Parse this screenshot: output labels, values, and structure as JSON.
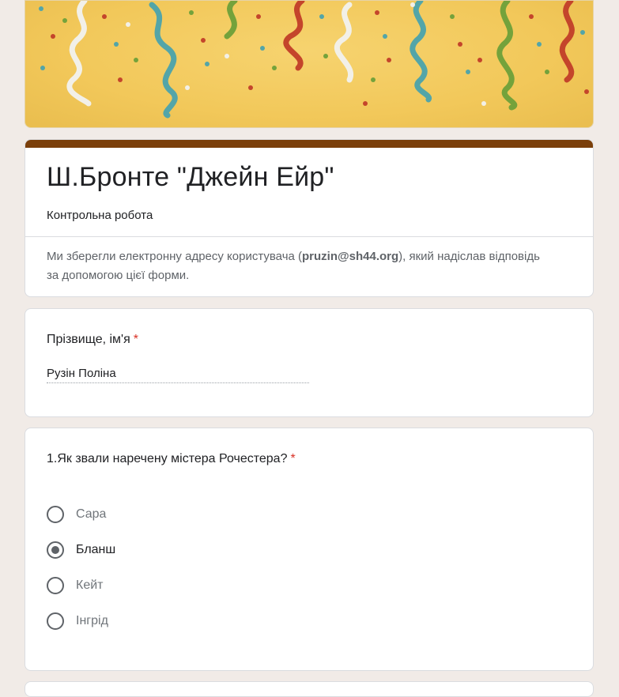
{
  "colors": {
    "page_bg": "#f1ebe7",
    "theme_accent": "#7b3f0a",
    "banner_bg": "#f2c85a",
    "required_star": "#d93025"
  },
  "form": {
    "title": "Ш.Бронте \"Джейн Ейр\"",
    "description": "Контрольна робота",
    "email_prefix": "Ми зберегли електронну адресу користувача (",
    "email": "pruzin@sh44.org",
    "email_suffix": "), який надіслав відповідь за допомогою цієї форми."
  },
  "questions": {
    "name": {
      "title": "Прізвище, ім'я",
      "required_mark": "*",
      "answer": "Рузін Поліна"
    },
    "q1": {
      "title": "1.Як звали наречену містера Рочестера?",
      "required_mark": "*",
      "options": [
        {
          "label": "Сара",
          "selected": false
        },
        {
          "label": "Бланш",
          "selected": true
        },
        {
          "label": "Кейт",
          "selected": false
        },
        {
          "label": "Інгрід",
          "selected": false
        }
      ]
    }
  }
}
